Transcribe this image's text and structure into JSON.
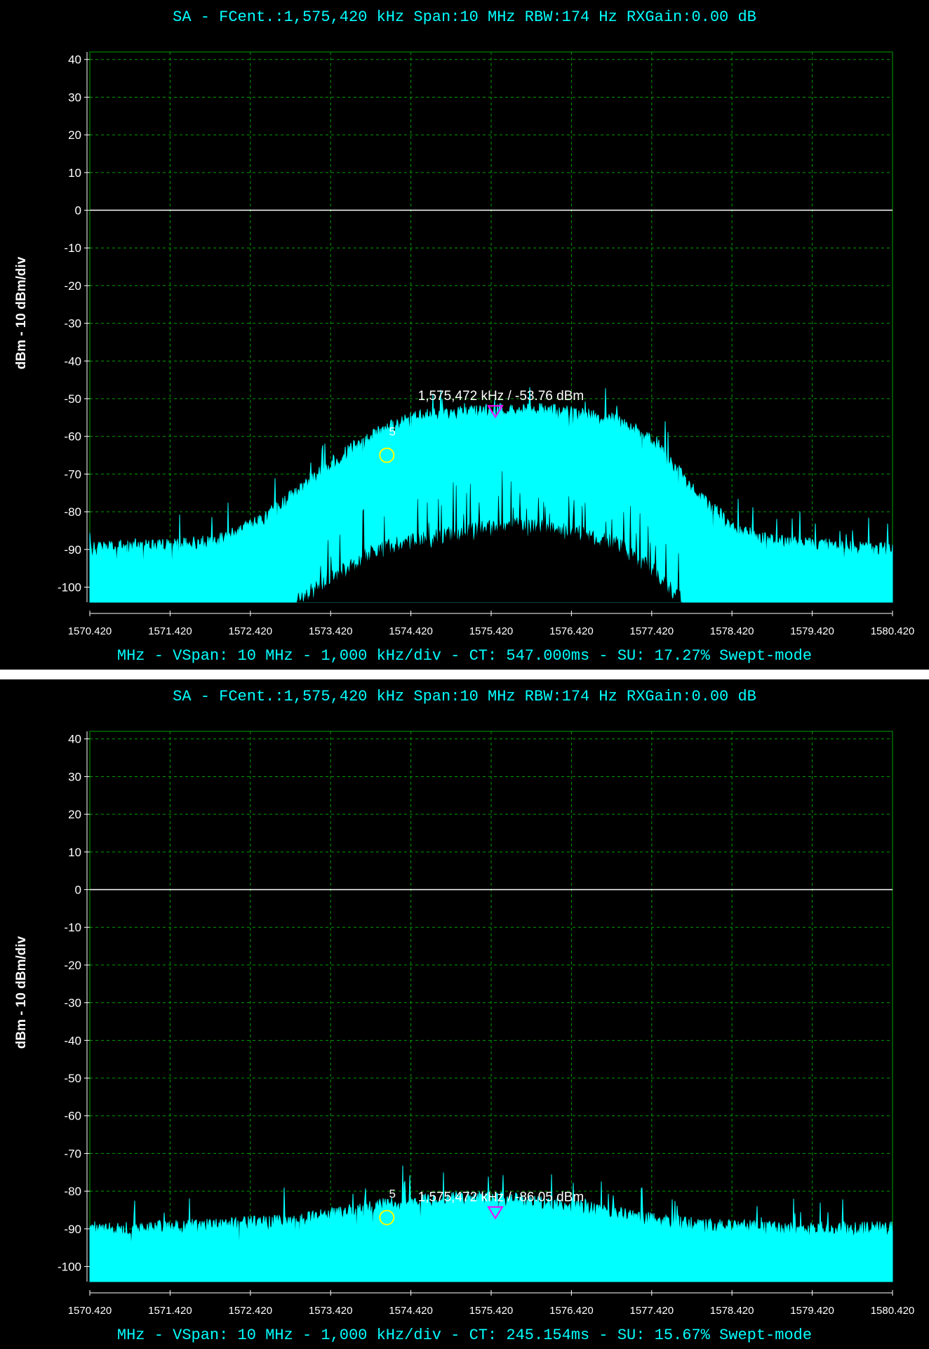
{
  "chart_data": [
    {
      "type": "area",
      "title": "SA - FCent.:1,575,420 kHz Span:10 MHz RBW:174 Hz RXGain:0.00 dB",
      "footer": "MHz - VSpan: 10 MHz - 1,000 kHz/div - CT: 547.000ms - SU: 17.27% Swept-mode",
      "ylabel": "dBm - 10 dBm/div",
      "xlim": [
        1570.42,
        1580.42
      ],
      "ylim": [
        -104,
        42
      ],
      "x_ticks": [
        "1570.420",
        "1571.420",
        "1572.420",
        "1573.420",
        "1574.420",
        "1575.420",
        "1576.420",
        "1577.420",
        "1578.420",
        "1579.420",
        "1580.420"
      ],
      "y_ticks": [
        "40",
        "30",
        "20",
        "10",
        "0",
        "-10",
        "-20",
        "-30",
        "-40",
        "-50",
        "-60",
        "-70",
        "-80",
        "-90",
        "-100"
      ],
      "grid": true,
      "reference_line_dbm": 0,
      "marker": {
        "label": "1,575,472 kHz / -53.76 dBm",
        "freq_mhz": 1575.472,
        "level_dbm": -53.76
      },
      "cursor": {
        "label": "5",
        "freq_mhz": 1574.12,
        "level_dbm": -65
      },
      "series": [
        {
          "x": [
            1570.42,
            1571.0,
            1571.5,
            1572.0,
            1572.5,
            1573.0,
            1573.5,
            1574.0,
            1574.5,
            1575.0,
            1575.5,
            1576.0,
            1576.5,
            1577.0,
            1577.5,
            1578.0,
            1578.5,
            1579.0,
            1579.5,
            1580.42
          ],
          "values": [
            -90,
            -89,
            -89,
            -88,
            -83,
            -75,
            -66,
            -59,
            -55,
            -54,
            -53,
            -53,
            -54,
            -56,
            -62,
            -76,
            -85,
            -88,
            -89,
            -90
          ]
        },
        {
          "x": [
            1573.0,
            1573.5,
            1574.0,
            1574.5,
            1575.0,
            1575.5,
            1576.0,
            1576.5,
            1577.0,
            1577.5,
            1577.8
          ],
          "values": [
            -104,
            -97,
            -90,
            -88,
            -86,
            -84,
            -84,
            -86,
            -89,
            -97,
            -104
          ]
        }
      ]
    },
    {
      "type": "area",
      "title": "SA - FCent.:1,575,420 kHz Span:10 MHz RBW:174 Hz RXGain:0.00 dB",
      "footer": "MHz - VSpan: 10 MHz - 1,000 kHz/div - CT: 245.154ms - SU: 15.67% Swept-mode",
      "ylabel": "dBm - 10 dBm/div",
      "xlim": [
        1570.42,
        1580.42
      ],
      "ylim": [
        -104,
        42
      ],
      "x_ticks": [
        "1570.420",
        "1571.420",
        "1572.420",
        "1573.420",
        "1574.420",
        "1575.420",
        "1576.420",
        "1577.420",
        "1578.420",
        "1579.420",
        "1580.420"
      ],
      "y_ticks": [
        "40",
        "30",
        "20",
        "10",
        "0",
        "-10",
        "-20",
        "-30",
        "-40",
        "-50",
        "-60",
        "-70",
        "-80",
        "-90",
        "-100"
      ],
      "grid": true,
      "reference_line_dbm": 0,
      "marker": {
        "label": "1,575,472 kHz / -86.05 dBm",
        "freq_mhz": 1575.472,
        "level_dbm": -86.05
      },
      "cursor": {
        "label": "5",
        "freq_mhz": 1574.12,
        "level_dbm": -87
      },
      "series": [
        {
          "x": [
            1570.42,
            1571.0,
            1572.0,
            1573.0,
            1573.5,
            1574.0,
            1574.5,
            1575.0,
            1575.5,
            1576.0,
            1576.5,
            1577.0,
            1577.5,
            1578.0,
            1579.0,
            1580.42
          ],
          "values": [
            -90,
            -90,
            -89,
            -88,
            -86,
            -84,
            -83,
            -82,
            -82,
            -83,
            -84,
            -86,
            -88,
            -89,
            -90,
            -90
          ]
        }
      ]
    }
  ]
}
